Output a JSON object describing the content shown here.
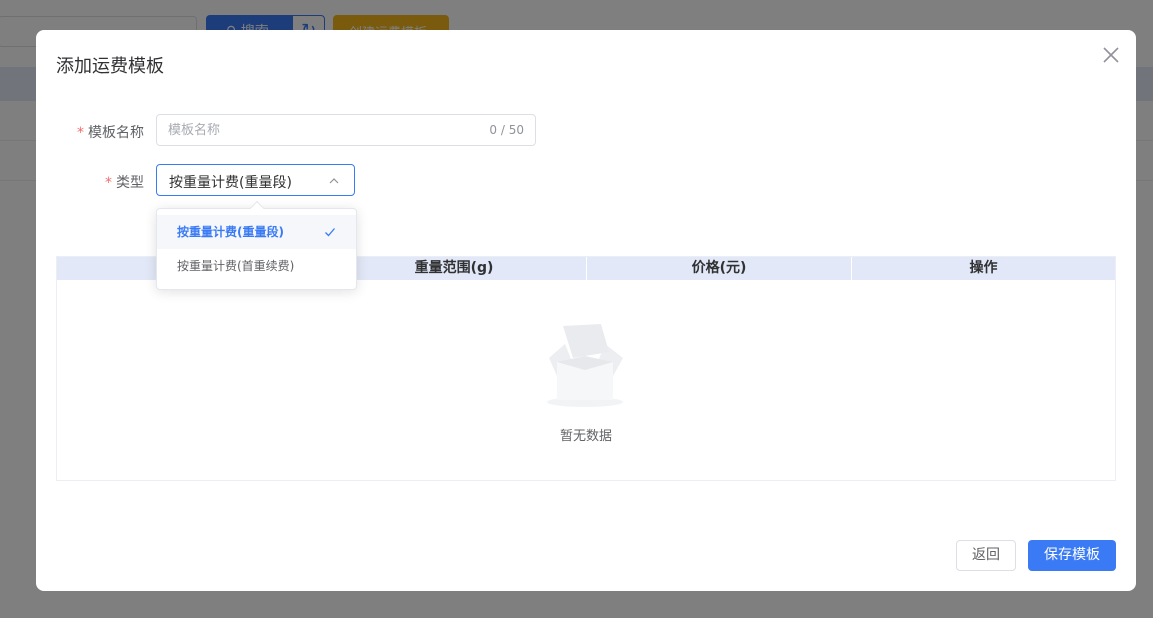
{
  "background": {
    "search_button_label": "搜索",
    "create_button_label": "创建运费模板"
  },
  "modal": {
    "title": "添加运费模板",
    "form": {
      "name_label": "模板名称",
      "name_placeholder": "模板名称",
      "name_value": "",
      "name_counter": "0 / 50",
      "type_label": "类型",
      "type_value": "按重量计费(重量段)",
      "required_mark": "*"
    },
    "type_options": [
      {
        "label": "按重量计费(重量段)",
        "selected": true
      },
      {
        "label": "按重量计费(首重续费)",
        "selected": false
      }
    ],
    "table": {
      "columns": [
        "",
        "重量范围(g)",
        "价格(元)",
        "操作"
      ],
      "empty_text": "暂无数据"
    },
    "buttons": {
      "back": "返回",
      "save": "保存模板"
    }
  },
  "colors": {
    "primary": "#3a7bf5",
    "required": "#f56c6c",
    "table_header": "#e2e8f7",
    "create_button": "#f5b41a"
  }
}
